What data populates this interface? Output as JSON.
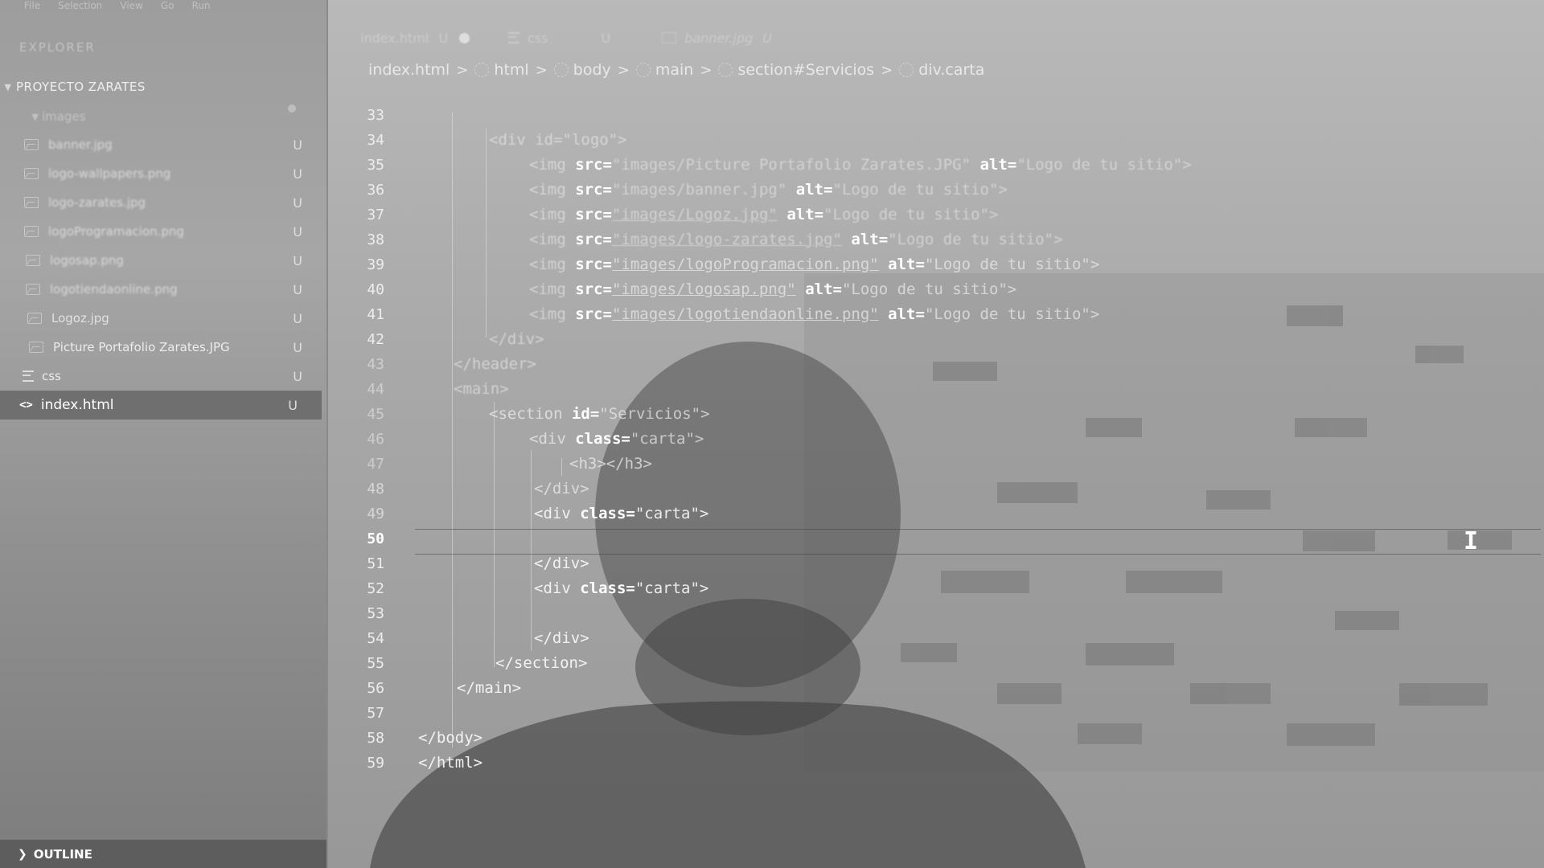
{
  "sidebar": {
    "menu": [
      "File",
      "Selection",
      "View",
      "Go",
      "Run"
    ],
    "explorer_title": "EXPLORER",
    "project": "PROYECTO ZARATES",
    "folder": "images",
    "files": [
      {
        "name": "banner.jpg",
        "badge": "U"
      },
      {
        "name": "logo-wallpapers.png",
        "badge": "U"
      },
      {
        "name": "logo-zarates.jpg",
        "badge": "U"
      },
      {
        "name": "logoProgramacion.png",
        "badge": "U"
      },
      {
        "name": "logosap.png",
        "badge": "U"
      },
      {
        "name": "logotiendaonline.png",
        "badge": "U"
      },
      {
        "name": "Logoz.jpg",
        "badge": "U"
      },
      {
        "name": "Picture Portafolio Zarates.JPG",
        "badge": "U"
      }
    ],
    "css_folder": {
      "name": "css",
      "badge": "U"
    },
    "active_file": {
      "name": "index.html",
      "badge": "U"
    },
    "outline_label": "OUTLINE"
  },
  "tabs": [
    {
      "label": "index.html",
      "badge": "U"
    },
    {
      "label": "css",
      "badge": "U"
    },
    {
      "label": "banner.jpg",
      "badge": "U"
    }
  ],
  "breadcrumb": [
    "index.html",
    "html",
    "body",
    "main",
    "section#Servicios",
    "div.carta"
  ],
  "code": {
    "current_line": 50,
    "lines": [
      {
        "n": "33"
      },
      {
        "n": "34"
      },
      {
        "n": "35"
      },
      {
        "n": "36"
      },
      {
        "n": "37"
      },
      {
        "n": "38"
      },
      {
        "n": "39"
      },
      {
        "n": "40"
      },
      {
        "n": "41"
      },
      {
        "n": "42"
      },
      {
        "n": "43"
      },
      {
        "n": "44"
      },
      {
        "n": "45"
      },
      {
        "n": "46"
      },
      {
        "n": "47"
      },
      {
        "n": "48"
      },
      {
        "n": "49"
      },
      {
        "n": "50"
      },
      {
        "n": "51"
      },
      {
        "n": "52"
      },
      {
        "n": "53"
      },
      {
        "n": "54"
      },
      {
        "n": "55"
      },
      {
        "n": "56"
      },
      {
        "n": "57"
      },
      {
        "n": "58"
      },
      {
        "n": "59"
      }
    ],
    "snippets": {
      "l34": "<div id=\"logo\">",
      "img_tag": "<img ",
      "src_attr": "src=",
      "alt_attr": "alt=",
      "src35": "\"images/Picture Portafolio Zarates.JPG\"",
      "alt35": "\"Logo de tu sitio\">",
      "src36": "\"images/banner.jpg\"",
      "alt36": "\"Logo de tu sitio\">",
      "src37": "\"images/Logoz.jpg\"",
      "alt37": "\"Logo de tu sitio\">",
      "src38": "\"images/logo-zarates.jpg\"",
      "alt38": "\"Logo de tu sitio\">",
      "src39": "\"images/logoProgramacion.png\"",
      "alt39": "\"Logo de tu sitio\">",
      "src40": "\"images/logosap.png\"",
      "alt40": "\"Logo de tu sitio\">",
      "src41": "\"images/logotiendaonline.png\"",
      "alt41": "\"Logo de tu sitio\">",
      "l42": "</div>",
      "l43": "</header>",
      "l44": "<main>",
      "l45_open": "<section ",
      "l45_attr": "id=",
      "l45_val": "\"Servicios\">",
      "div_open": "<div ",
      "class_attr": "class=",
      "carta_val": "\"carta\">",
      "l47": "<h3></h3>",
      "div_close": "</div>",
      "l55": "</section>",
      "l56": "</main>",
      "l58": "</body>",
      "l59": "</html>"
    }
  }
}
